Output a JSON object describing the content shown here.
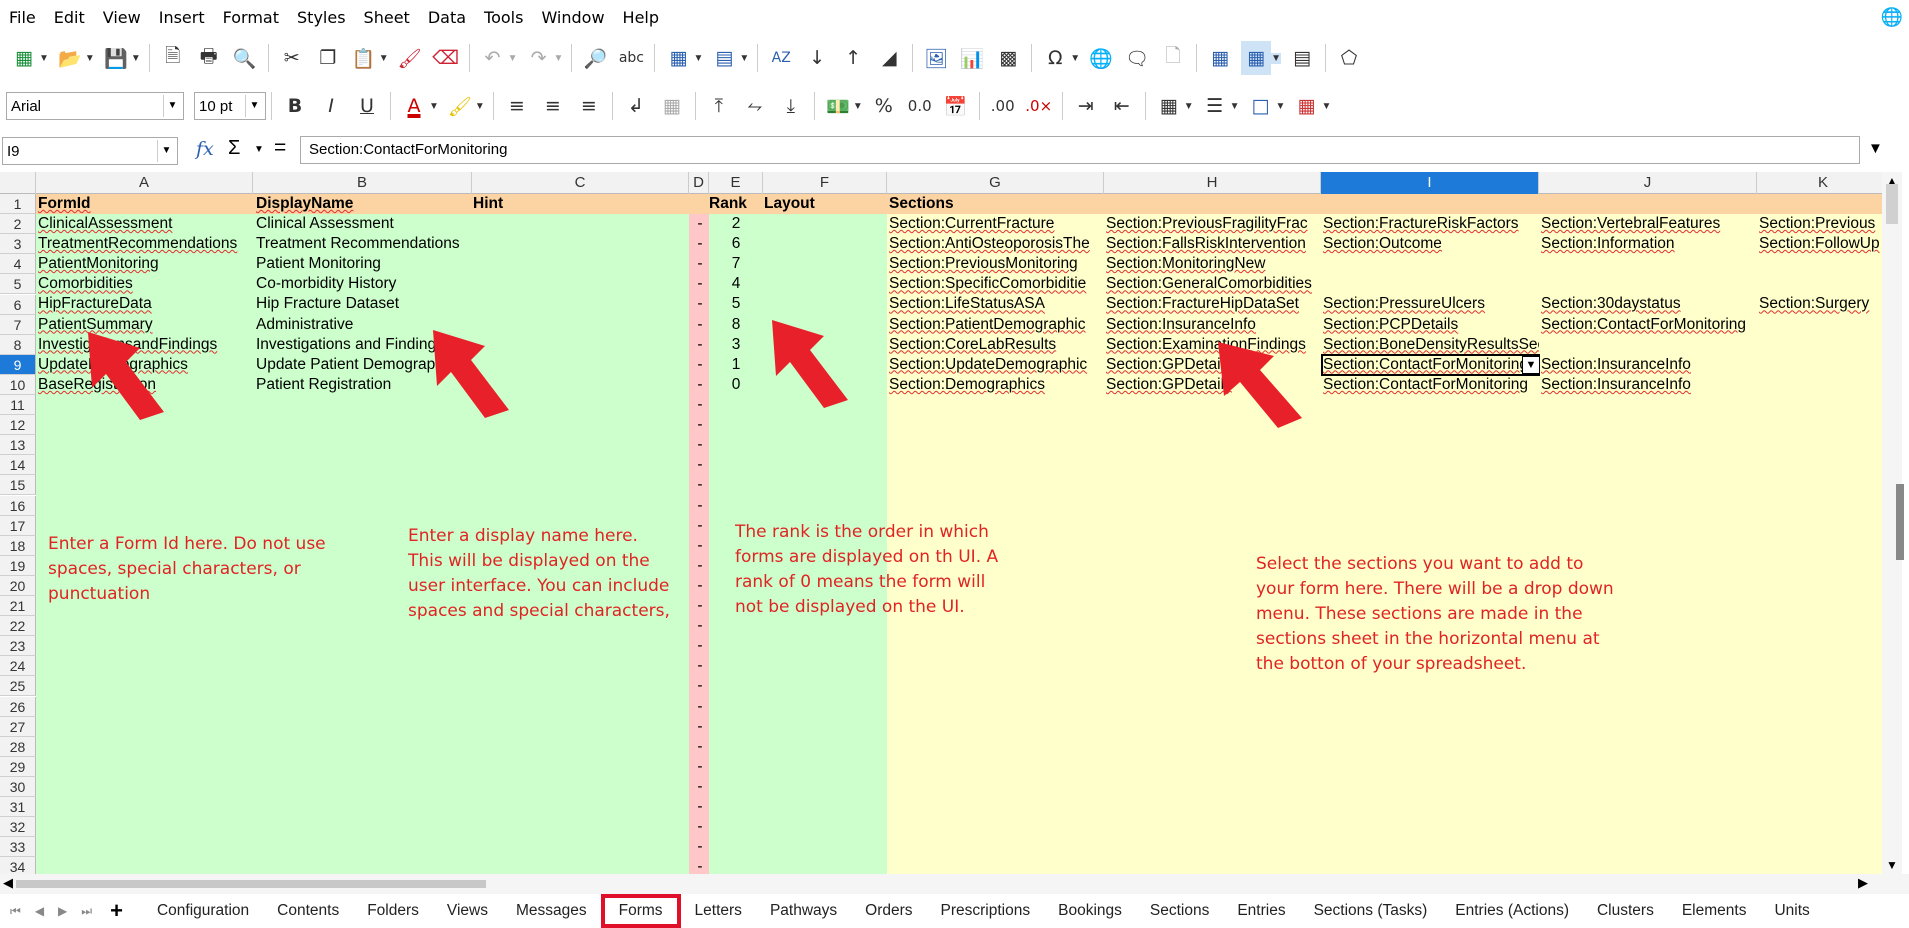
{
  "menu": [
    "File",
    "Edit",
    "View",
    "Insert",
    "Format",
    "Styles",
    "Sheet",
    "Data",
    "Tools",
    "Window",
    "Help"
  ],
  "toolbar": {
    "font_name": "Arial",
    "font_size": "10 pt"
  },
  "formula_bar": {
    "name_box": "I9",
    "content": "Section:ContactForMonitoring"
  },
  "columns": [
    "A",
    "B",
    "C",
    "D",
    "E",
    "F",
    "G",
    "H",
    "I",
    "J",
    "K"
  ],
  "header_row": {
    "formid": "FormId",
    "displayname": "DisplayName",
    "hint": "Hint",
    "rank": "Rank",
    "layout": "Layout",
    "sections": "Sections"
  },
  "rows": [
    {
      "formid": "ClinicalAssessment",
      "display": "Clinical Assessment",
      "d": "-",
      "rank": "2",
      "g": "Section:CurrentFracture",
      "h": "Section:PreviousFragilityFrac",
      "i": "Section:FractureRiskFactors",
      "j": "Section:VertebralFeatures",
      "k": "Section:Previous"
    },
    {
      "formid": "TreatmentRecommendations",
      "display": "Treatment Recommendations",
      "d": "-",
      "rank": "6",
      "g": "Section:AntiOsteoporosisThe",
      "h": "Section:FallsRiskIntervention",
      "i": "Section:Outcome",
      "j": "Section:Information",
      "k": "Section:FollowUp"
    },
    {
      "formid": "PatientMonitoring",
      "display": "Patient Monitoring",
      "d": "-",
      "rank": "7",
      "g": "Section:PreviousMonitoring",
      "h": "Section:MonitoringNew",
      "i": "",
      "j": "",
      "k": ""
    },
    {
      "formid": "Comorbidities",
      "display": "Co-morbidity History",
      "d": "-",
      "rank": "4",
      "g": "Section:SpecificComorbiditie",
      "h": "Section:GeneralComorbidities",
      "i": "",
      "j": "",
      "k": ""
    },
    {
      "formid": "HipFractureData",
      "display": "Hip Fracture Dataset",
      "d": "-",
      "rank": "5",
      "g": "Section:LifeStatusASA",
      "h": "Section:FractureHipDataSet",
      "i": "Section:PressureUlcers",
      "j": "Section:30daystatus",
      "k": "Section:Surgery"
    },
    {
      "formid": "PatientSummary",
      "display": "Administrative",
      "d": "-",
      "rank": "8",
      "g": "Section:PatientDemographic",
      "h": "Section:InsuranceInfo",
      "i": "Section:PCPDetails",
      "j": "Section:ContactForMonitoring",
      "k": ""
    },
    {
      "formid": "InvestigationsandFindings",
      "display": "Investigations and Findings",
      "d": "-",
      "rank": "3",
      "g": "Section:CoreLabResults",
      "h": "Section:ExaminationFindings",
      "i": "Section:BoneDensityResultsSection",
      "j": "",
      "k": ""
    },
    {
      "formid": "UpdateDemographics",
      "display": "Update Patient Demographics",
      "d": "-",
      "rank": "1",
      "g": "Section:UpdateDemographic",
      "h": "Section:GPDetails",
      "i": "Section:ContactForMonitoring",
      "j": "Section:InsuranceInfo",
      "k": ""
    },
    {
      "formid": "BaseRegistration",
      "display": "Patient Registration",
      "d": "-",
      "rank": "0",
      "g": "Section:Demographics",
      "h": "Section:GPDetails",
      "i": "Section:ContactForMonitoring",
      "j": "Section:InsuranceInfo",
      "k": ""
    }
  ],
  "notes": {
    "formid": "Enter a Form Id here. Do not use spaces, special characters, or punctuation",
    "display": "Enter a display name here. This will be displayed on the user interface. You can include spaces and special characters,",
    "rank": "The rank is the order in which forms are displayed on th UI. A rank of 0 means the form will not be displayed on the UI.",
    "sections": "Select the sections you want to add to your form here. There will be a drop down menu. These sections are made in the sections sheet in the horizontal menu at the botton of your spreadsheet."
  },
  "sheet_tabs": [
    "Configuration",
    "Contents",
    "Folders",
    "Views",
    "Messages",
    "Forms",
    "Letters",
    "Pathways",
    "Orders",
    "Prescriptions",
    "Bookings",
    "Sections",
    "Entries",
    "Sections (Tasks)",
    "Entries (Actions)",
    "Clusters",
    "Elements",
    "Units"
  ],
  "active_tab": "Forms",
  "colors": {
    "header_orange": "#fcd3a2",
    "green_band": "#ccffcc",
    "yellow_band": "#ffffcc",
    "pink_band": "#ffc7c7",
    "annotation_red": "#e02424",
    "selection_blue": "#1d7ad8"
  }
}
